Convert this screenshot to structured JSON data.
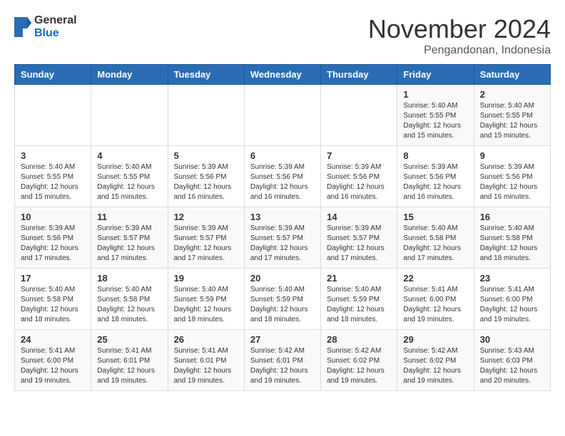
{
  "header": {
    "logo": {
      "general": "General",
      "blue": "Blue"
    },
    "month": "November 2024",
    "location": "Pengandonan, Indonesia"
  },
  "weekdays": [
    "Sunday",
    "Monday",
    "Tuesday",
    "Wednesday",
    "Thursday",
    "Friday",
    "Saturday"
  ],
  "weeks": [
    [
      {
        "day": "",
        "info": ""
      },
      {
        "day": "",
        "info": ""
      },
      {
        "day": "",
        "info": ""
      },
      {
        "day": "",
        "info": ""
      },
      {
        "day": "",
        "info": ""
      },
      {
        "day": "1",
        "info": "Sunrise: 5:40 AM\nSunset: 5:55 PM\nDaylight: 12 hours\nand 15 minutes."
      },
      {
        "day": "2",
        "info": "Sunrise: 5:40 AM\nSunset: 5:55 PM\nDaylight: 12 hours\nand 15 minutes."
      }
    ],
    [
      {
        "day": "3",
        "info": "Sunrise: 5:40 AM\nSunset: 5:55 PM\nDaylight: 12 hours\nand 15 minutes."
      },
      {
        "day": "4",
        "info": "Sunrise: 5:40 AM\nSunset: 5:55 PM\nDaylight: 12 hours\nand 15 minutes."
      },
      {
        "day": "5",
        "info": "Sunrise: 5:39 AM\nSunset: 5:56 PM\nDaylight: 12 hours\nand 16 minutes."
      },
      {
        "day": "6",
        "info": "Sunrise: 5:39 AM\nSunset: 5:56 PM\nDaylight: 12 hours\nand 16 minutes."
      },
      {
        "day": "7",
        "info": "Sunrise: 5:39 AM\nSunset: 5:56 PM\nDaylight: 12 hours\nand 16 minutes."
      },
      {
        "day": "8",
        "info": "Sunrise: 5:39 AM\nSunset: 5:56 PM\nDaylight: 12 hours\nand 16 minutes."
      },
      {
        "day": "9",
        "info": "Sunrise: 5:39 AM\nSunset: 5:56 PM\nDaylight: 12 hours\nand 16 minutes."
      }
    ],
    [
      {
        "day": "10",
        "info": "Sunrise: 5:39 AM\nSunset: 5:56 PM\nDaylight: 12 hours\nand 17 minutes."
      },
      {
        "day": "11",
        "info": "Sunrise: 5:39 AM\nSunset: 5:57 PM\nDaylight: 12 hours\nand 17 minutes."
      },
      {
        "day": "12",
        "info": "Sunrise: 5:39 AM\nSunset: 5:57 PM\nDaylight: 12 hours\nand 17 minutes."
      },
      {
        "day": "13",
        "info": "Sunrise: 5:39 AM\nSunset: 5:57 PM\nDaylight: 12 hours\nand 17 minutes."
      },
      {
        "day": "14",
        "info": "Sunrise: 5:39 AM\nSunset: 5:57 PM\nDaylight: 12 hours\nand 17 minutes."
      },
      {
        "day": "15",
        "info": "Sunrise: 5:40 AM\nSunset: 5:58 PM\nDaylight: 12 hours\nand 17 minutes."
      },
      {
        "day": "16",
        "info": "Sunrise: 5:40 AM\nSunset: 5:58 PM\nDaylight: 12 hours\nand 18 minutes."
      }
    ],
    [
      {
        "day": "17",
        "info": "Sunrise: 5:40 AM\nSunset: 5:58 PM\nDaylight: 12 hours\nand 18 minutes."
      },
      {
        "day": "18",
        "info": "Sunrise: 5:40 AM\nSunset: 5:58 PM\nDaylight: 12 hours\nand 18 minutes."
      },
      {
        "day": "19",
        "info": "Sunrise: 5:40 AM\nSunset: 5:59 PM\nDaylight: 12 hours\nand 18 minutes."
      },
      {
        "day": "20",
        "info": "Sunrise: 5:40 AM\nSunset: 5:59 PM\nDaylight: 12 hours\nand 18 minutes."
      },
      {
        "day": "21",
        "info": "Sunrise: 5:40 AM\nSunset: 5:59 PM\nDaylight: 12 hours\nand 18 minutes."
      },
      {
        "day": "22",
        "info": "Sunrise: 5:41 AM\nSunset: 6:00 PM\nDaylight: 12 hours\nand 19 minutes."
      },
      {
        "day": "23",
        "info": "Sunrise: 5:41 AM\nSunset: 6:00 PM\nDaylight: 12 hours\nand 19 minutes."
      }
    ],
    [
      {
        "day": "24",
        "info": "Sunrise: 5:41 AM\nSunset: 6:00 PM\nDaylight: 12 hours\nand 19 minutes."
      },
      {
        "day": "25",
        "info": "Sunrise: 5:41 AM\nSunset: 6:01 PM\nDaylight: 12 hours\nand 19 minutes."
      },
      {
        "day": "26",
        "info": "Sunrise: 5:41 AM\nSunset: 6:01 PM\nDaylight: 12 hours\nand 19 minutes."
      },
      {
        "day": "27",
        "info": "Sunrise: 5:42 AM\nSunset: 6:01 PM\nDaylight: 12 hours\nand 19 minutes."
      },
      {
        "day": "28",
        "info": "Sunrise: 5:42 AM\nSunset: 6:02 PM\nDaylight: 12 hours\nand 19 minutes."
      },
      {
        "day": "29",
        "info": "Sunrise: 5:42 AM\nSunset: 6:02 PM\nDaylight: 12 hours\nand 19 minutes."
      },
      {
        "day": "30",
        "info": "Sunrise: 5:43 AM\nSunset: 6:03 PM\nDaylight: 12 hours\nand 20 minutes."
      }
    ]
  ]
}
